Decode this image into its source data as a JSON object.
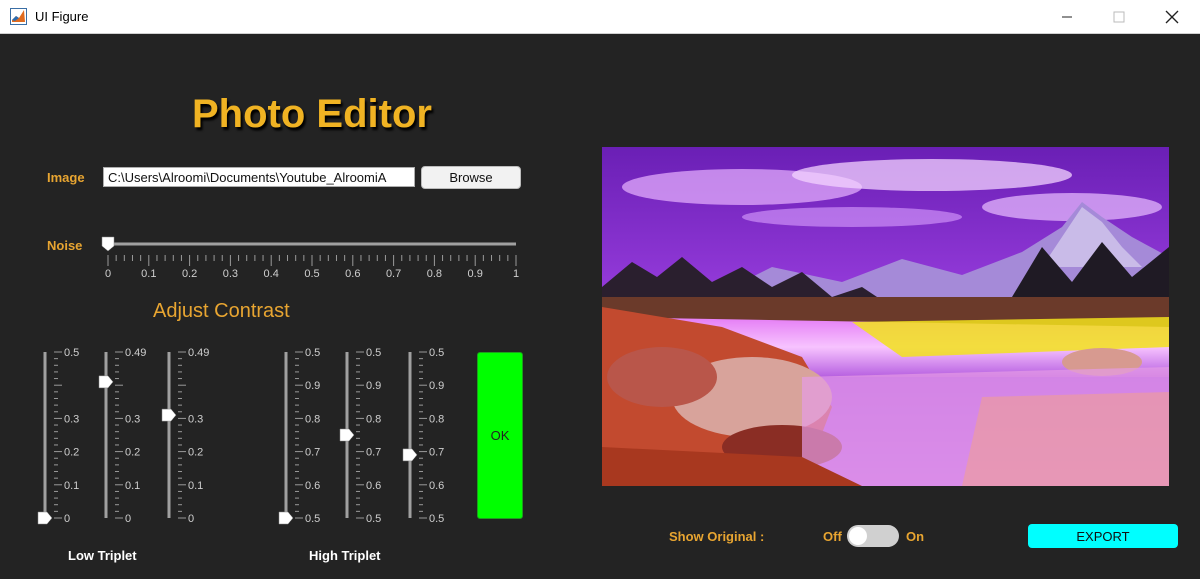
{
  "window": {
    "title": "UI Figure"
  },
  "app": {
    "title": "Photo Editor"
  },
  "image_field": {
    "label": "Image",
    "value": "C:\\Users\\Alroomi\\Documents\\Youtube_AlroomiA",
    "browse_label": "Browse"
  },
  "noise": {
    "label": "Noise",
    "value": 0,
    "ticks": [
      "0",
      "0.1",
      "0.2",
      "0.3",
      "0.4",
      "0.5",
      "0.6",
      "0.7",
      "0.8",
      "0.9",
      "1"
    ]
  },
  "contrast": {
    "title": "Adjust Contrast",
    "low_triplet": {
      "label": "Low Triplet",
      "sliders": [
        {
          "value": 0,
          "top_label": "0.5",
          "tick_labels": [
            "0.3",
            "0.2",
            "0.1",
            "0"
          ]
        },
        {
          "value": 0.41,
          "top_label": "0.49",
          "tick_labels": [
            "0.3",
            "0.2",
            "0.1",
            "0"
          ]
        },
        {
          "value": 0.31,
          "top_label": "0.49",
          "tick_labels": [
            "0.3",
            "0.2",
            "0.1",
            "0"
          ]
        }
      ]
    },
    "high_triplet": {
      "label": "High Triplet",
      "sliders": [
        {
          "value": 0.5,
          "top_label": "0.5",
          "tick_labels": [
            "0.9",
            "0.8",
            "0.7",
            "0.6",
            "0.5"
          ]
        },
        {
          "value": 0.75,
          "top_label": "0.5",
          "tick_labels": [
            "0.9",
            "0.8",
            "0.7",
            "0.6",
            "0.5"
          ]
        },
        {
          "value": 0.69,
          "top_label": "0.5",
          "tick_labels": [
            "0.9",
            "0.8",
            "0.7",
            "0.6",
            "0.5"
          ]
        }
      ]
    },
    "ok_label": "OK"
  },
  "show_original": {
    "label": "Show Original  :",
    "off_label": "Off",
    "on_label": "On",
    "state": "off"
  },
  "export_label": "EXPORT"
}
